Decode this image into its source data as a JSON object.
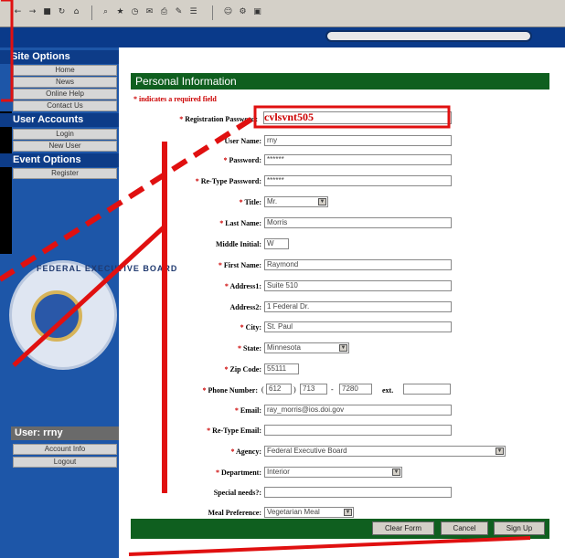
{
  "toolbar": {
    "icons": [
      "back-icon",
      "forward-icon",
      "stop-icon",
      "refresh-icon",
      "home-icon",
      "search-icon",
      "favorites-icon",
      "history-icon",
      "mail-icon",
      "print-icon",
      "edit-icon",
      "discuss-icon",
      "messenger-icon",
      "tools-icon"
    ]
  },
  "sidebar": {
    "site_options": {
      "header": "Site Options",
      "items": [
        "Home",
        "News",
        "Online Help",
        "Contact Us"
      ]
    },
    "user_accounts": {
      "header": "User Accounts",
      "items": [
        "Login",
        "New User"
      ]
    },
    "event_options": {
      "header": "Event Options",
      "items": [
        "Register"
      ]
    },
    "seal_text": "FEDERAL EXECUTIVE BOARD",
    "user_box": {
      "header": "User: rrny",
      "items": [
        "Account Info",
        "Logout"
      ]
    }
  },
  "form": {
    "title": "Personal Information",
    "required_note": "* indicates a required field",
    "registration_password": {
      "label": "Registration Password:",
      "value": "cvlsvnt505"
    },
    "user_name": {
      "label": "User Name:",
      "value": "rny"
    },
    "password": {
      "label": "Password:",
      "value": "******"
    },
    "retype_password": {
      "label": "Re-Type Password:",
      "value": "******"
    },
    "title_field": {
      "label": "Title:",
      "value": "Mr."
    },
    "last_name": {
      "label": "Last Name:",
      "value": "Morris"
    },
    "middle_initial": {
      "label": "Middle Initial:",
      "value": "W"
    },
    "first_name": {
      "label": "First Name:",
      "value": "Raymond"
    },
    "address1": {
      "label": "Address1:",
      "value": "Suite 510"
    },
    "address2": {
      "label": "Address2:",
      "value": "1 Federal Dr."
    },
    "city": {
      "label": "City:",
      "value": "St. Paul"
    },
    "state": {
      "label": "State:",
      "value": "Minnesota"
    },
    "zip": {
      "label": "Zip Code:",
      "value": "55111"
    },
    "phone": {
      "label": "Phone Number:",
      "area": "612",
      "prefix": "713",
      "line": "7280",
      "ext_label": "ext.",
      "ext": ""
    },
    "email": {
      "label": "Email:",
      "value": "ray_morris@ios.doi.gov"
    },
    "retype_email": {
      "label": "Re-Type Email:",
      "value": ""
    },
    "agency": {
      "label": "Agency:",
      "value": "Federal Executive Board"
    },
    "department": {
      "label": "Department:",
      "value": "Interior"
    },
    "special_needs": {
      "label": "Special needs?:",
      "value": ""
    },
    "meal_preference": {
      "label": "Meal Preference:",
      "value": "Vegetarian Meal"
    },
    "buttons": {
      "clear": "Clear Form",
      "cancel": "Cancel",
      "signup": "Sign Up"
    }
  },
  "colors": {
    "sidebar_blue": "#1d56a8",
    "form_green": "#0f5f1f",
    "annotation_red": "#e01010"
  }
}
